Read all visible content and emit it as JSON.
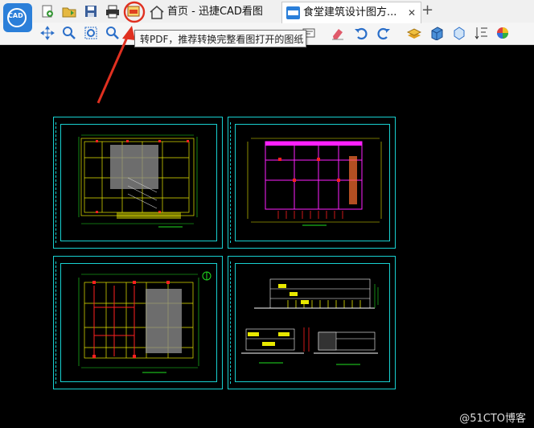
{
  "app": {
    "logo_text": "CAD"
  },
  "tabs": [
    {
      "label": "首页 - 迅捷CAD看图"
    },
    {
      "label": "食堂建筑设计图方...",
      "close": "✕"
    }
  ],
  "add_tab_label": "+",
  "tooltip": {
    "text": "转PDF，推荐转换完整看图打开的图纸"
  },
  "watermark": "@51CTO博客",
  "colors": {
    "accent": "#2b7fd9",
    "highlight_circle": "#e03020",
    "arrow": "#e03020",
    "frame_cyan": "#18d0d0",
    "plan_yellow": "#e8e800",
    "plan_red": "#ff2020",
    "plan_magenta": "#ff20ff",
    "plan_green": "#20e020",
    "canvas": "#000000"
  },
  "toolbar_row1_icons": [
    "new-file-icon",
    "open-folder-icon",
    "save-icon",
    "print-icon",
    "convert-pdf-icon"
  ],
  "toolbar_row2_icons": [
    "pan-icon",
    "zoom-realtime-icon",
    "zoom-window-icon",
    "zoom-extents-icon",
    "measure-icon",
    "edit-icon",
    "eraser-icon",
    "undo-icon",
    "redo-icon",
    "layers-icon",
    "3d-box-icon",
    "3d-view-icon",
    "text-sort-icon",
    "color-wheel-icon"
  ]
}
